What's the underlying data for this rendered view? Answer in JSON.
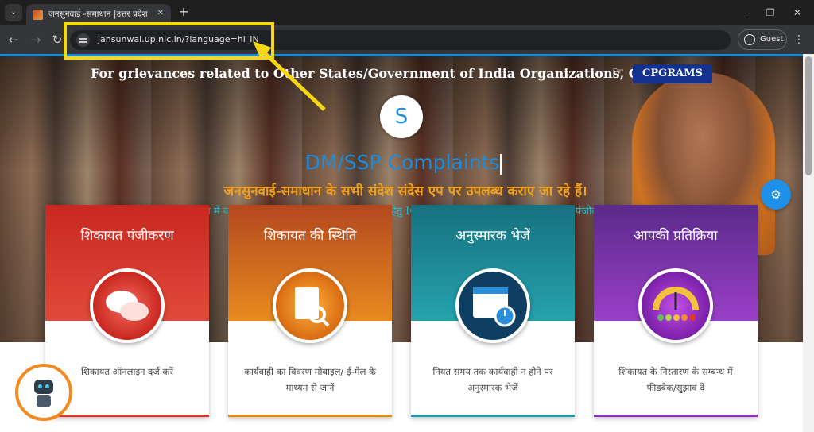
{
  "browser": {
    "tab_title": "जनसुनवाई -समाधान |उत्तर प्रदेश स",
    "url": "jansunwai.up.nic.in/?language=hi_IN",
    "profile_label": "Guest",
    "icons": {
      "tab_menu": "chevron-down-icon",
      "new_tab": "plus-icon",
      "back": "arrow-left-icon",
      "forward": "arrow-right-icon",
      "reload": "reload-icon",
      "site_info": "tune-icon",
      "menu": "kebab-icon"
    }
  },
  "page": {
    "notice": "For grievances related to Other States/Government of India Organizations, Click",
    "cpgrams_label": "CPGRAMS",
    "logo_letter": "S",
    "typing_title": "DM/SSP Complaints",
    "headline": "जनसुनवाई-समाधान के सभी संदेश संदेस एप पर उपलब्ध कराए जा रहे हैं।",
    "subline": "संदेस एप में जनसुनवाई सम्बन्धी सभी सूचनाएं प्राप्त करने हेतु IGRS एवं संदेस एप दोनों में एक ही नंबर से पंजीकरण करें",
    "cards": [
      {
        "title": "शिकायत पंजीकरण",
        "desc": "शिकायत ऑनलाइन दर्ज करें",
        "icon": "chat-bubbles-icon",
        "color": "#d8342c"
      },
      {
        "title": "शिकायत की स्थिति",
        "desc": "कार्यवाही का विवरण मोबाइल/ ई-मेल के माध्यम से जानें",
        "icon": "document-search-icon",
        "color": "#e08a16"
      },
      {
        "title": "अनुस्मारक भेजें",
        "desc": "नियत समय तक कार्यवाही न होने पर अनुस्मारक भेजें",
        "icon": "calendar-clock-icon",
        "color": "#1f9aa6"
      },
      {
        "title": "आपकी प्रतिक्रिया",
        "desc": "शिकायत के निस्तारण के सम्बन्ध में फीडबैक/सुझाव दें",
        "icon": "feedback-meter-icon",
        "color": "#8a2fb8"
      }
    ],
    "fab_icon": "gears-icon",
    "bot_icon": "robot-icon"
  },
  "annotation": {
    "color": "#f6d712"
  }
}
